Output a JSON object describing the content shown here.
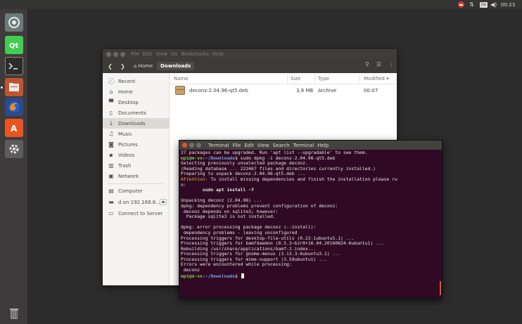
{
  "top_panel": {
    "keyboard": "De",
    "volume": "◀)",
    "clock": "00:23"
  },
  "launcher": {
    "items": [
      "system-settings",
      "qt-creator",
      "terminal",
      "files",
      "firefox",
      "software-center",
      "tools"
    ]
  },
  "files_window": {
    "menu": [
      "File",
      "Edit",
      "View",
      "Go",
      "Bookmarks",
      "Help"
    ],
    "path_home": "Home",
    "path_current": "Downloads",
    "sidebar": [
      {
        "label": "Recent",
        "icon": "🕘"
      },
      {
        "label": "Home",
        "icon": "⌂"
      },
      {
        "label": "Desktop",
        "icon": "▀"
      },
      {
        "label": "Documents",
        "icon": "▯"
      },
      {
        "label": "Downloads",
        "icon": "↓"
      },
      {
        "label": "Music",
        "icon": "♫"
      },
      {
        "label": "Pictures",
        "icon": "◙"
      },
      {
        "label": "Videos",
        "icon": "▪"
      },
      {
        "label": "Trash",
        "icon": "▥"
      },
      {
        "label": "Network",
        "icon": "▣"
      },
      {
        "label": "Computer",
        "icon": "▤"
      },
      {
        "label": "d on 192.168.8...",
        "icon": "▬"
      },
      {
        "label": "Connect to Server",
        "icon": "▭"
      }
    ],
    "columns": {
      "name": "Name",
      "size": "Size",
      "type": "Type",
      "modified": "Modified ▾"
    },
    "file": {
      "name": "deconz-2.04.96-qt5.deb",
      "size": "3,9 MB",
      "type": "Archive",
      "modified": "00:07"
    }
  },
  "terminal": {
    "menu": [
      "Terminal",
      "File",
      "Edit",
      "View",
      "Search",
      "Terminal",
      "Help"
    ],
    "prompt_user": "mpi@m-vn",
    "prompt_path": ":~/Downloads",
    "prompt_sign": "$ ",
    "command": "sudo dpkg -i deconz-2.04.96-qt5.deb",
    "lines_before": [
      "27 packages can be upgraded. Run 'apt list --upgradable' to see them."
    ],
    "lines_after_1": [
      "Selecting previously unselected package deconz.",
      "(Reading database ... 222467 files and directories currently installed.)",
      "Preparing to unpack deconz-2.04.96-qt5.deb ..."
    ],
    "attention_label": "Attention:",
    "attention_text": " To install missing dependencies and finish the installation please ru",
    "attention_wrap": "n:",
    "blank": "",
    "fix_command": "        sudo apt install -f",
    "lines_after_2": [
      "Unpacking deconz (2.04.96) ...",
      "dpkg: dependency problems prevent configuration of deconz:",
      " deconz depends on sqlite3; however:",
      "  Package sqlite3 is not installed.",
      "",
      "dpkg: error processing package deconz (--install):",
      " dependency problems - leaving unconfigured",
      "Processing triggers for desktop-file-utils (0.22-1ubuntu5.1) ...",
      "Processing triggers for bamfdaemon (0.5.3~bzr0+16.04.20160824-0ubuntu1) ...",
      "Rebuilding /usr/share/applications/bamf-2.index...",
      "Processing triggers for gnome-menus (3.13.3-6ubuntu3.1) ...",
      "Processing triggers for mime-support (3.59ubuntu1) ...",
      "Errors were encountered while processing:",
      " deconz"
    ]
  },
  "colors": {
    "terminal_bg": "#300a24",
    "prompt_green": "#78c848",
    "prompt_blue": "#7aa4de",
    "attention": "#e9b23a",
    "ubuntu_orange": "#e9541f"
  }
}
